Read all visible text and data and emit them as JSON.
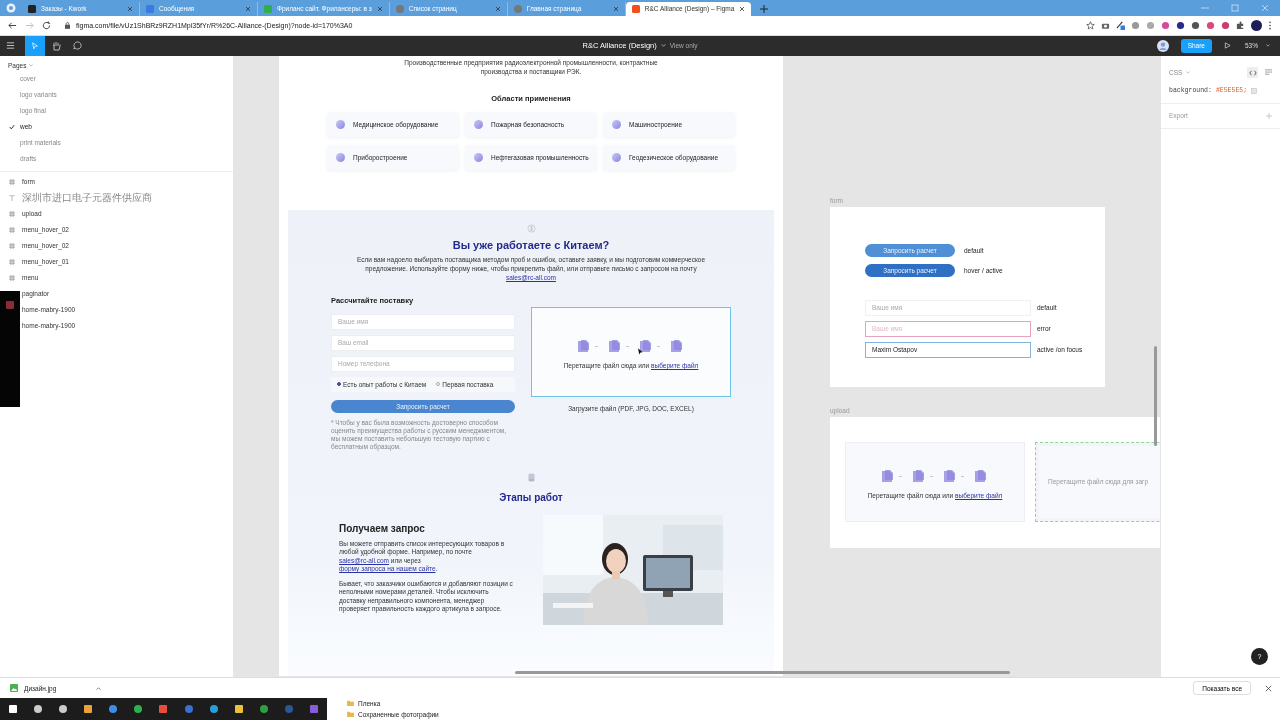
{
  "browser": {
    "tabs": [
      {
        "title": "Заказы - Kwork",
        "selected": false
      },
      {
        "title": "Сообщения",
        "selected": false
      },
      {
        "title": "Фриланс сайт. Фрилансеры: в з",
        "selected": false
      },
      {
        "title": "Список страниц",
        "selected": false
      },
      {
        "title": "Главная страница",
        "selected": false
      },
      {
        "title": "R&C Alliance (Design) – Figma",
        "selected": true
      }
    ],
    "url": "figma.com/file/vUz1ShBRz9RZH1Mpi35fYr/R%26C-Alliance-(Design)?node-id=170%3A0"
  },
  "toolbar": {
    "file_title": "R&C Alliance (Design)",
    "mode": "View only",
    "share": "Share",
    "zoom": "53%"
  },
  "sidebar": {
    "pages_header": "Pages",
    "pages": [
      {
        "name": "cover",
        "selected": false
      },
      {
        "name": "logo variants",
        "selected": false
      },
      {
        "name": "logo final",
        "selected": false
      },
      {
        "name": "web",
        "selected": true
      },
      {
        "name": "print materials",
        "selected": false
      },
      {
        "name": "drafts",
        "selected": false
      }
    ],
    "layers": [
      {
        "name": "form",
        "kind": "frame"
      },
      {
        "name": "深圳市进口电子元器件供应商",
        "kind": "text"
      },
      {
        "name": "upload",
        "kind": "frame"
      },
      {
        "name": "menu_hover_02",
        "kind": "frame"
      },
      {
        "name": "menu_hover_02",
        "kind": "frame"
      },
      {
        "name": "menu_hover_01",
        "kind": "frame"
      },
      {
        "name": "menu",
        "kind": "frame"
      },
      {
        "name": "paginator",
        "kind": "covered"
      },
      {
        "name": "home-mabry-1900",
        "kind": "covered"
      },
      {
        "name": "home-mabry-1900",
        "kind": "covered"
      }
    ]
  },
  "web_frame": {
    "intro": "Производственные предприятия радиоэлектронной промышленности, контрактные производства и поставщики РЭК.",
    "areas_title": "Области применения",
    "areas": [
      "Медицинское оборудование",
      "Пожарная безопасность",
      "Машиностроение",
      "Приборостроение",
      "Нефтегазовая промышленность",
      "Геодезическое оборудование"
    ],
    "china": {
      "title": "Вы уже работаете с Китаем?",
      "text": "Если вам надоело выбирать поставщика методом проб и ошибок, оставьте заявку, и мы подготовим коммерческое предложение. Используйте форму ниже, чтобы прикрепить файл, или отправьте письмо с запросом на почту",
      "link": "sales@rc-all.com"
    },
    "form": {
      "title": "Рассчитайте поставку",
      "fields": [
        {
          "placeholder": "Ваше имя"
        },
        {
          "placeholder": "Ваш email"
        },
        {
          "placeholder": "Номер телефона"
        }
      ],
      "radios": [
        {
          "label": "Есть опыт работы с Китаем",
          "selected": true
        },
        {
          "label": "Первая поставка",
          "selected": false
        }
      ],
      "button": "Запросить расчет",
      "note": "* Чтобы у вас была возможность достоверно способом оценить преимущества работы с русским менеджментом, мы можем поставить небольшую тестовую партию с бесплатным образцом."
    },
    "upload": {
      "text": "Перетащите файл сюда или",
      "link": "выберите файл",
      "caption": "Загрузите файл (PDF, JPG, DOC, EXCEL)"
    },
    "stages_title": "Этапы работ",
    "step": {
      "title": "Получаем запрос",
      "paragraphs": [
        [
          {
            "text": "Вы можете отправить список интересующих товаров в любой удобной форме. Например, по почте"
          },
          {
            "link": "sales@rc-all.com"
          },
          {
            "text": "или через"
          },
          {
            "link": "форму запроса на нашем сайте"
          },
          {
            "text": "."
          }
        ],
        [
          {
            "text": "Бывает, что заказчики ошибаются и добавляют позиции с неполными номерами деталей. Чтобы исключить доставку неправильного компонента, менеджер проверяет правильность каждого артикула в запросе."
          }
        ]
      ],
      "photo": {
        "kind": "picture"
      }
    }
  },
  "form_frame": {
    "label": "form",
    "buttons": [
      {
        "label": "Запросить расчет",
        "state": "default",
        "kind": "default"
      },
      {
        "label": "Запросить расчет",
        "state": "hover / active",
        "kind": "hover"
      }
    ],
    "fields": [
      {
        "placeholder": "Ваше имя",
        "state": "default",
        "kind": "default"
      },
      {
        "placeholder": "Ваше имя",
        "state": "error",
        "kind": "error"
      },
      {
        "value": "Maxim Ostapov",
        "state": "active /on focus",
        "kind": "focus"
      }
    ]
  },
  "upload_frame": {
    "label": "upload",
    "boxes": [
      {
        "kind": "default",
        "text": "Перетащите файл сюда или",
        "link": "выберите файл"
      },
      {
        "kind": "dragover",
        "text": "Перетащите файл сюда для загр"
      }
    ]
  },
  "inspector": {
    "tab": "CSS",
    "property": "background:",
    "value": "#E5E5E5;",
    "export": "Export",
    "help": "?"
  },
  "downloads": {
    "file": "Дизайн.jpg",
    "show_all": "Показать все"
  },
  "taskbar_popup": [
    "Пленка",
    "Сохраненные фотографии"
  ]
}
